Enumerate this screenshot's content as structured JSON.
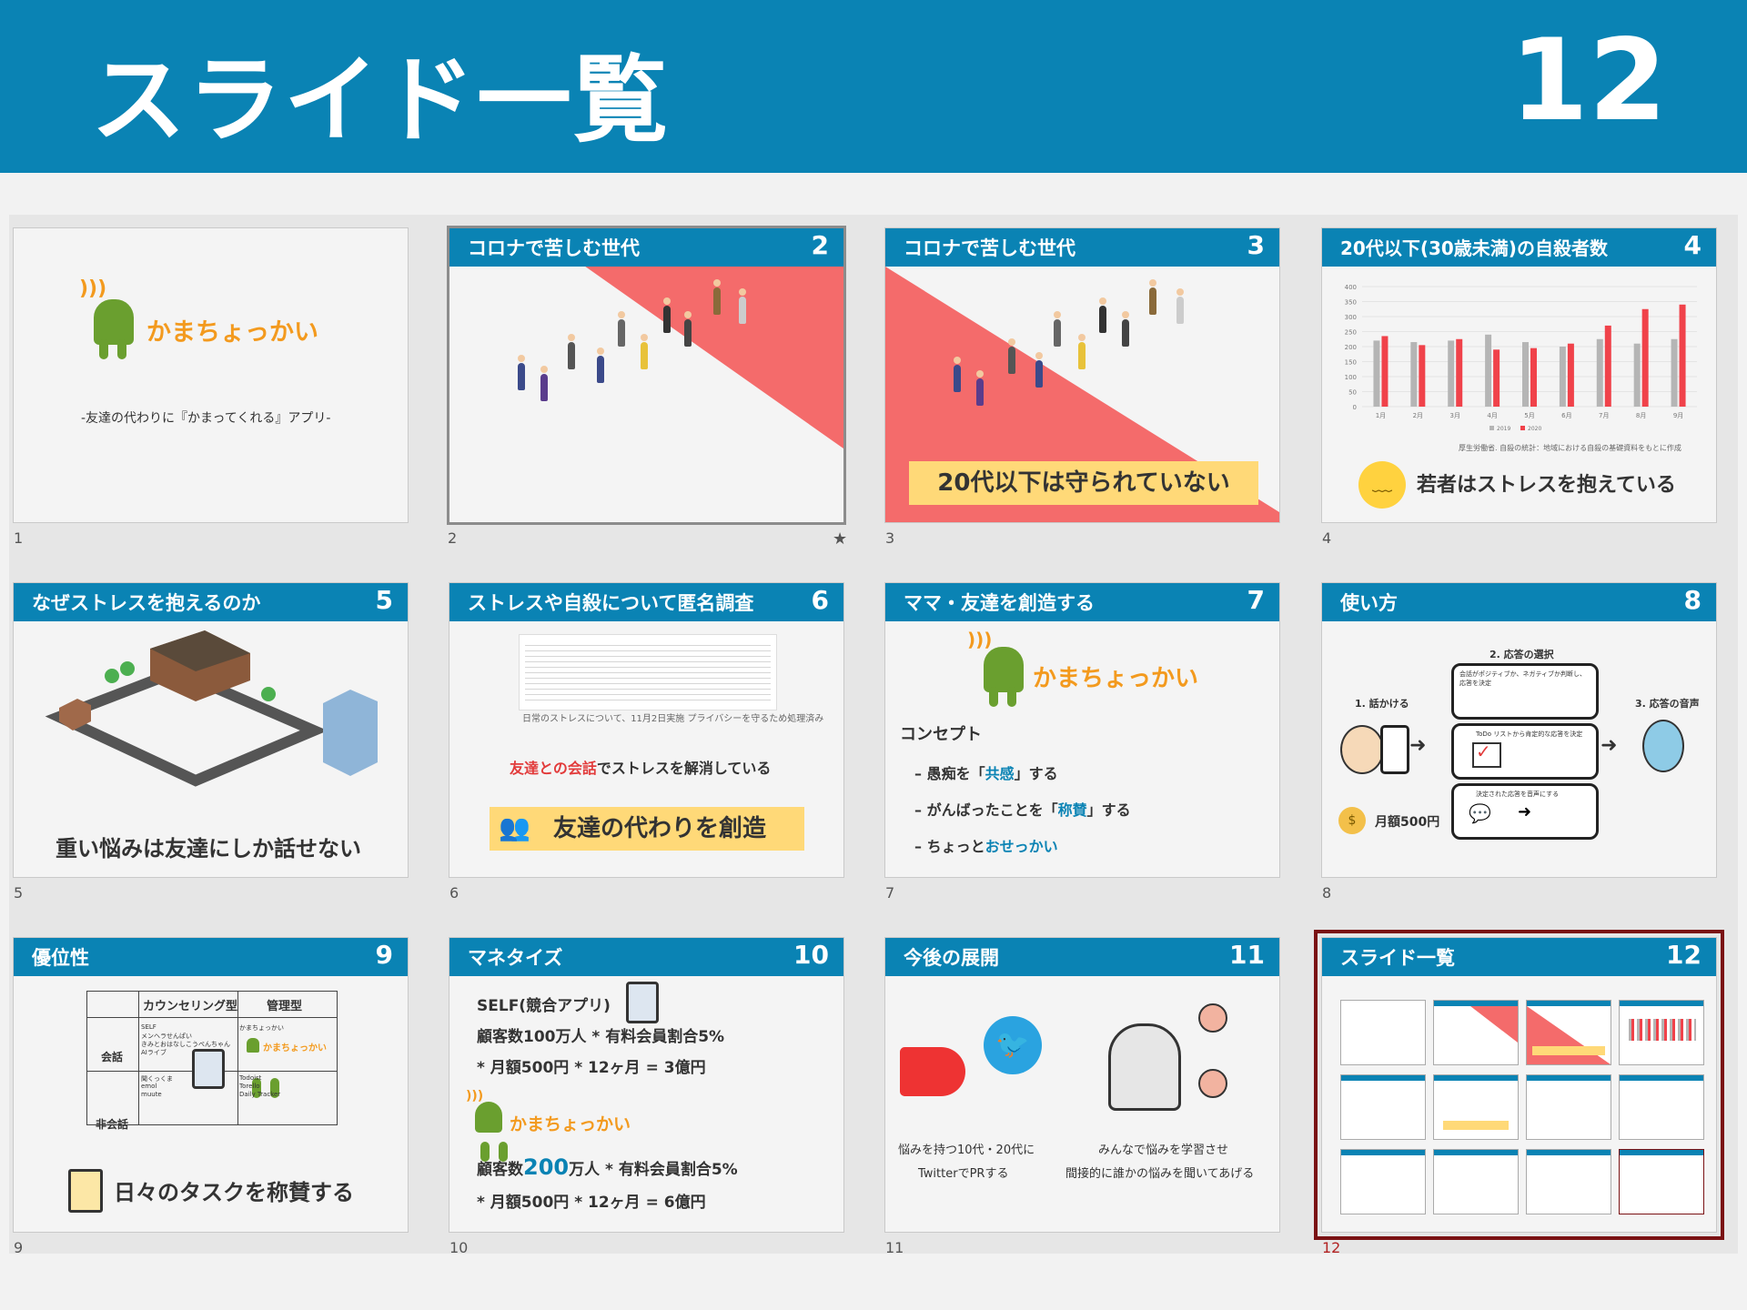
{
  "header": {
    "title": "スライド一覧",
    "page_number": "12"
  },
  "slides": [
    {
      "index": "1",
      "logo": "かまちょっかい",
      "subtitle": "-友達の代わりに『かまってくれる』アプリ-"
    },
    {
      "index": "2",
      "title": "コロナで苦しむ世代",
      "number": "2",
      "star": "★"
    },
    {
      "index": "3",
      "title": "コロナで苦しむ世代",
      "number": "3",
      "banner": "20代以下は守られていない"
    },
    {
      "index": "4",
      "title": "20代以下(30歳未満)の自殺者数",
      "number": "4",
      "caption": "若者はストレスを抱えている",
      "source": "厚生労働省. 自殺の統計：地域における自殺の基礎資料をもとに作成",
      "legend": [
        "2019",
        "2020"
      ]
    },
    {
      "index": "5",
      "title": "なぜストレスを抱えるのか",
      "number": "5",
      "caption": "重い悩みは友達にしか話せない"
    },
    {
      "index": "6",
      "title": "ストレスや自殺について匿名調査",
      "number": "6",
      "doc_caption": "日常のストレスについて、11月2日実施 プライバシーを守るため処理済み",
      "line_red": "友達との会話",
      "line_rest": "でストレスを解消している",
      "banner": "友達の代わりを創造"
    },
    {
      "index": "7",
      "title": "ママ・友達を創造する",
      "number": "7",
      "logo": "かまちょっかい",
      "concept": "コンセプト",
      "items": [
        {
          "pre": "– 愚痴を「",
          "em": "共感",
          "post": "」する"
        },
        {
          "pre": "– がんばったことを「",
          "em": "称賛",
          "post": "」する"
        },
        {
          "pre": "– ちょっと",
          "em": "おせっかい",
          "post": ""
        }
      ]
    },
    {
      "index": "8",
      "title": "使い方",
      "number": "8",
      "step1": "1. 話かける",
      "step2": "2. 応答の選択",
      "step3": "3. 応答の音声",
      "box1": "会話がポジティブか、ネガティブか判断し、応答を決定",
      "box2": "ToDo リストから肯定的な応答を決定",
      "box3": "決定された応答を音声にする",
      "price": "月額500円"
    },
    {
      "index": "9",
      "title": "優位性",
      "number": "9",
      "col1": "カウンセリング型",
      "col2": "管理型",
      "row1": "会話",
      "row2": "非会話",
      "c11": [
        "SELF",
        "メンヘラせんぱい",
        "きみとおはなしこうぺんちゃん",
        "AIライブ"
      ],
      "c12": "かまちょっかい",
      "c21": [
        "聞くっくま",
        "emol",
        "muute"
      ],
      "c22": [
        "Todoist",
        "Torello",
        "Daily Tracker"
      ],
      "caption": "日々のタスクを称賛する"
    },
    {
      "index": "10",
      "title": "マネタイズ",
      "number": "10",
      "l1": "SELF(競合アプリ)",
      "l2": "顧客数100万人 * 有料会員割合5%",
      "l3": "* 月額500円 * 12ヶ月 = 3億円",
      "logo": "かまちょっかい",
      "l4a": "顧客数",
      "l4b": "200",
      "l4c": "万人 * 有料会員割合5%",
      "l5": "* 月額500円 * 12ヶ月 = 6億円"
    },
    {
      "index": "11",
      "title": "今後の展開",
      "number": "11",
      "left1": "悩みを持つ10代・20代に",
      "left2": "TwitterでPRする",
      "right1": "みんなで悩みを学習させ",
      "right2": "間接的に誰かの悩みを聞いてあげる"
    },
    {
      "index": "12",
      "title": "スライド一覧",
      "number": "12"
    }
  ],
  "chart_data": {
    "type": "bar",
    "categories": [
      "1月",
      "2月",
      "3月",
      "4月",
      "5月",
      "6月",
      "7月",
      "8月",
      "9月"
    ],
    "series": [
      {
        "name": "2019",
        "values": [
          220,
          215,
          220,
          240,
          215,
          200,
          225,
          210,
          225
        ]
      },
      {
        "name": "2020",
        "values": [
          235,
          205,
          225,
          190,
          195,
          210,
          270,
          325,
          340
        ]
      }
    ],
    "ylim": [
      0,
      400
    ],
    "yticks": [
      0,
      50,
      100,
      150,
      200,
      250,
      300,
      350,
      400
    ],
    "colors": {
      "2019": "#b5b5b5",
      "2020": "#f0424a"
    }
  }
}
